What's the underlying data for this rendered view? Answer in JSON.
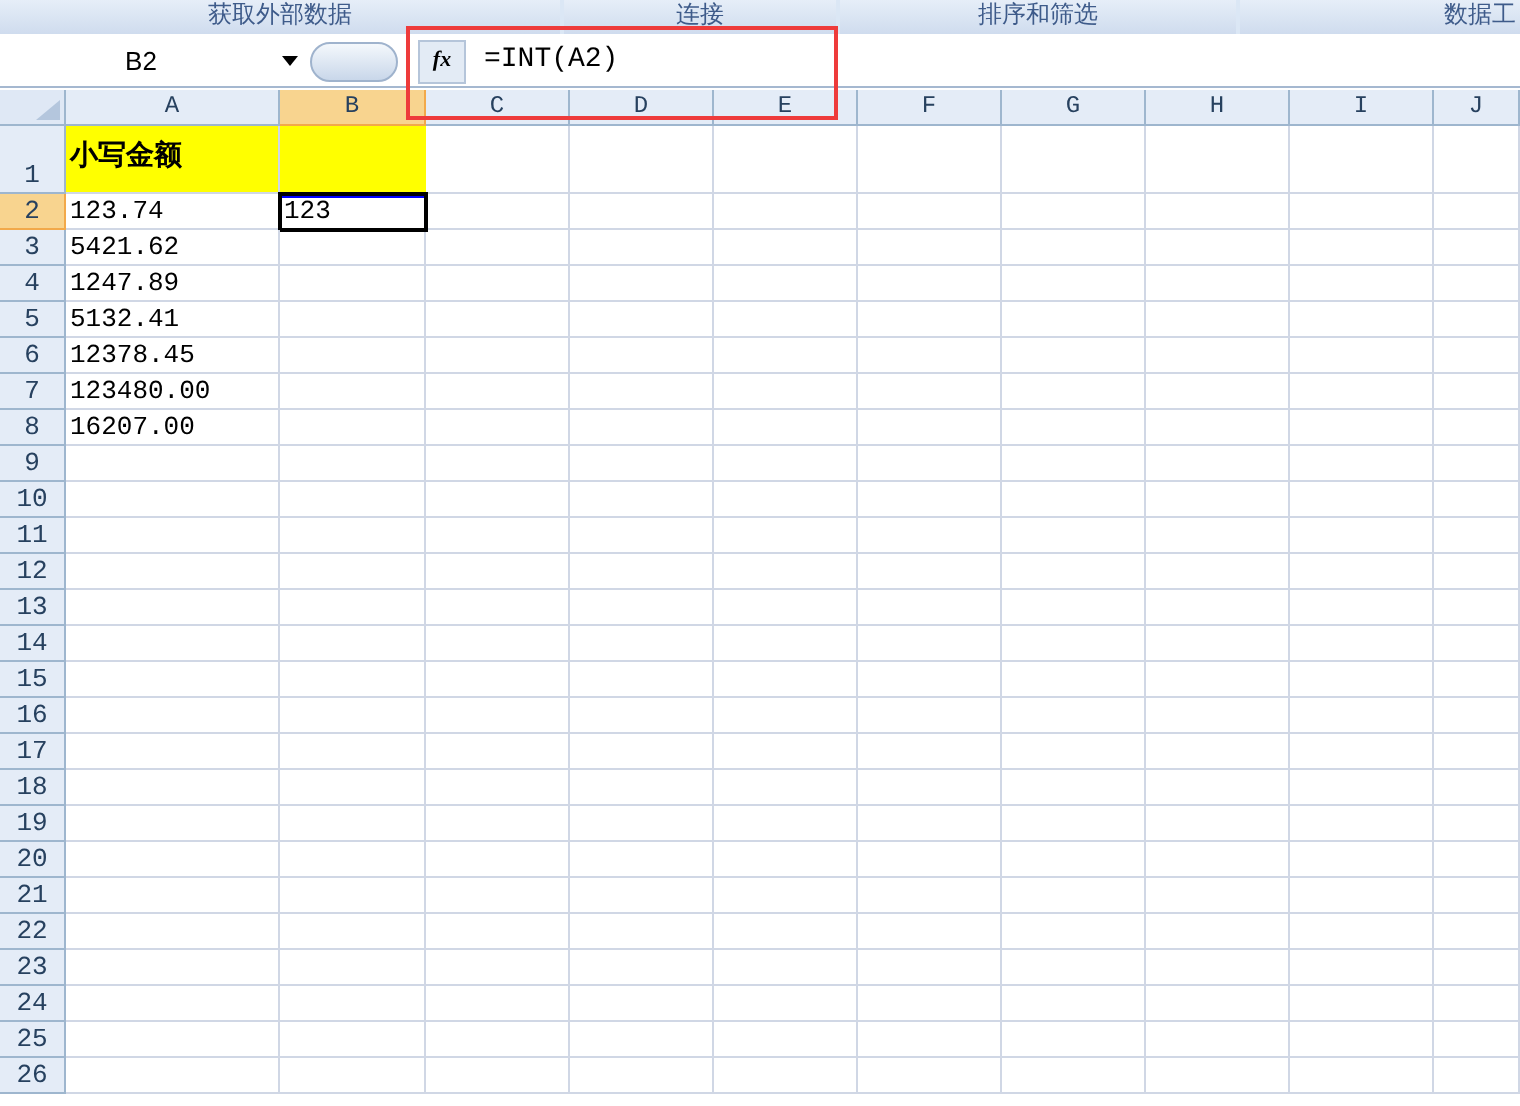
{
  "ribbon_groups": [
    {
      "label": "获取外部数据"
    },
    {
      "label": "连接"
    },
    {
      "label": "排序和筛选"
    },
    {
      "label": "数据工"
    }
  ],
  "name_box": "B2",
  "formula_button": "fx",
  "formula": "=INT(A2)",
  "columns": [
    {
      "label": "A",
      "selected": false
    },
    {
      "label": "B",
      "selected": true
    },
    {
      "label": "C",
      "selected": false
    },
    {
      "label": "D",
      "selected": false
    },
    {
      "label": "E",
      "selected": false
    },
    {
      "label": "F",
      "selected": false
    },
    {
      "label": "G",
      "selected": false
    },
    {
      "label": "H",
      "selected": false
    },
    {
      "label": "I",
      "selected": false
    },
    {
      "label": "J",
      "selected": false
    }
  ],
  "rows": [
    {
      "number": "1",
      "selected": false,
      "cells": [
        {
          "text": "小写金额",
          "highlighted": true,
          "active": false
        },
        {
          "highlighted": true,
          "active": false
        }
      ]
    },
    {
      "number": "2",
      "selected": true,
      "cells": [
        {
          "text": "123.74",
          "highlighted": false,
          "active": false
        },
        {
          "text": "123",
          "highlighted": false,
          "active": true
        }
      ]
    },
    {
      "number": "3",
      "selected": false,
      "cells": [
        {
          "text": "5421.62",
          "highlighted": false,
          "active": false
        }
      ]
    },
    {
      "number": "4",
      "selected": false,
      "cells": [
        {
          "text": "1247.89",
          "highlighted": false,
          "active": false
        }
      ]
    },
    {
      "number": "5",
      "selected": false,
      "cells": [
        {
          "text": "5132.41",
          "highlighted": false,
          "active": false
        }
      ]
    },
    {
      "number": "6",
      "selected": false,
      "cells": [
        {
          "text": "12378.45",
          "highlighted": false,
          "active": false
        }
      ]
    },
    {
      "number": "7",
      "selected": false,
      "cells": [
        {
          "text": "123480.00",
          "highlighted": false,
          "active": false
        }
      ]
    },
    {
      "number": "8",
      "selected": false,
      "cells": [
        {
          "text": "16207.00",
          "highlighted": false,
          "active": false
        }
      ]
    },
    {
      "number": "9",
      "selected": false
    },
    {
      "number": "10",
      "selected": false
    },
    {
      "number": "11",
      "selected": false
    },
    {
      "number": "12",
      "selected": false
    },
    {
      "number": "13",
      "selected": false
    },
    {
      "number": "14",
      "selected": false
    },
    {
      "number": "15",
      "selected": false
    },
    {
      "number": "16",
      "selected": false
    },
    {
      "number": "17",
      "selected": false
    },
    {
      "number": "18",
      "selected": false
    },
    {
      "number": "19",
      "selected": false
    },
    {
      "number": "20",
      "selected": false
    },
    {
      "number": "21",
      "selected": false
    },
    {
      "number": "22",
      "selected": false
    },
    {
      "number": "23",
      "selected": false
    },
    {
      "number": "24",
      "selected": false
    },
    {
      "number": "25",
      "selected": false
    },
    {
      "number": "26",
      "selected": false
    }
  ]
}
